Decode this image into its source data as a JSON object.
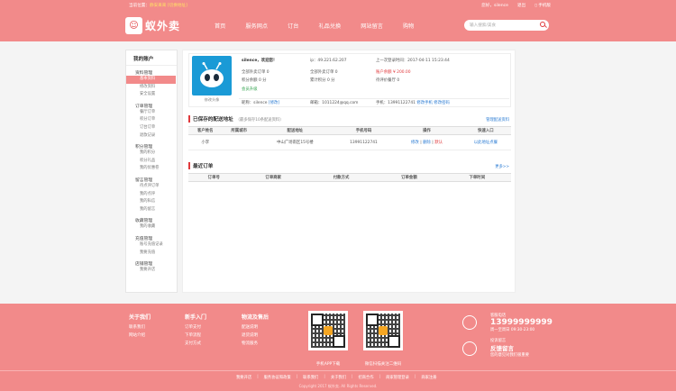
{
  "topbar": {
    "location_label": "当前位置：",
    "location_value": "静安来来",
    "switch_text": "[切换地址]",
    "greeting": "您好，silence",
    "logout": "退出",
    "mobile": "手机版"
  },
  "header": {
    "logo_text": "蚁外卖",
    "nav": [
      "首页",
      "服务网点",
      "订台",
      "礼品兑换",
      "网站留言",
      "购物"
    ],
    "search_placeholder": "输入搜索/美食"
  },
  "sidebar": {
    "title": "我的账户",
    "groups": [
      {
        "label": "资料管理",
        "items": [
          "基本资料",
          "修改资料",
          "安全设置"
        ]
      },
      {
        "label": "订单管理",
        "items": [
          "餐厅订单",
          "积分订单",
          "订台订单",
          "退款记录"
        ]
      },
      {
        "label": "积分管理",
        "items": [
          "我的积分",
          "积分礼品",
          "我的优惠卷"
        ]
      },
      {
        "label": "留言管理",
        "items": [
          "待点评订单",
          "我的点评",
          "我的私信",
          "我的留言"
        ]
      },
      {
        "label": "收藏管理",
        "items": [
          "我的收藏"
        ]
      },
      {
        "label": "充值管理",
        "items": [
          "账号充值记录",
          "我要充值"
        ]
      },
      {
        "label": "店铺管理",
        "items": [
          "我要开店"
        ]
      }
    ],
    "active_item": "基本资料"
  },
  "profile": {
    "name": "silence，欢迎您！",
    "ip": "ip：49.221.62.207",
    "last_login": "上一次登录时间：2017-04-11 15:23:44",
    "r1c1": "全部外卖订单 0",
    "r1c2": "全部外卖订单 0",
    "r1c3": "账户余额 ¥ 200.00",
    "r2c1": "积分余额 0 分",
    "r2c2": "累计积分 0 分",
    "r2c3": "待评价餐厅 0",
    "level_link": "会员升级",
    "avatar_label": "修改头像",
    "nickname": "昵称：silence",
    "nickname_edit": "[修改]",
    "email": "邮箱：1011224@qq.com",
    "phone_label": "手机：13991122741",
    "phone_edit": "修改手机",
    "pwd_edit": "修改密码"
  },
  "address": {
    "title": "已保存的配送地址",
    "note": "（最多保存10条配送资料）",
    "manage_link": "管理配送资料",
    "headers": [
      "客户姓名",
      "所属城市",
      "配送地址",
      "手机号码",
      "操作",
      "快速入口"
    ],
    "row": {
      "name": "小李",
      "city": "",
      "address": "中山广场南区15号楼",
      "phone": "13991122741",
      "op_edit": "修改",
      "op_del": "删除",
      "op_default": "默认",
      "quick": "以此地址点餐"
    }
  },
  "orders": {
    "title": "最近订单",
    "more_link": "更多>>",
    "headers": [
      "订单号",
      "订单商家",
      "付款方式",
      "订单金额",
      "下单时间"
    ]
  },
  "footer": {
    "col1": {
      "title": "关于我们",
      "items": [
        "联系我们",
        "网站介绍"
      ]
    },
    "col2": {
      "title": "新手入门",
      "items": [
        "订单支付",
        "下单流程",
        "支付方式"
      ]
    },
    "col3": {
      "title": "物流及售后",
      "items": [
        "配送说明",
        "退货说明",
        "物流服务"
      ]
    },
    "qr1_label": "手机APP下载",
    "qr2_label": "微信扫描关注二维码",
    "hotline_label": "客服电话",
    "hotline": "13999999999",
    "hours": "周一至周日 09:30-23:00",
    "feedback_small": "投诉留言",
    "feedback": "反馈留言",
    "feedback_note": "您的意见对我们很重要",
    "links": [
      "我要开店",
      "服务协议和政策",
      "联系我们",
      "关于我们",
      "招商合作",
      "商家管理登录",
      "商家注册"
    ],
    "copyright": "Copyright 2017 蚁外卖. All Rights Reserved."
  }
}
